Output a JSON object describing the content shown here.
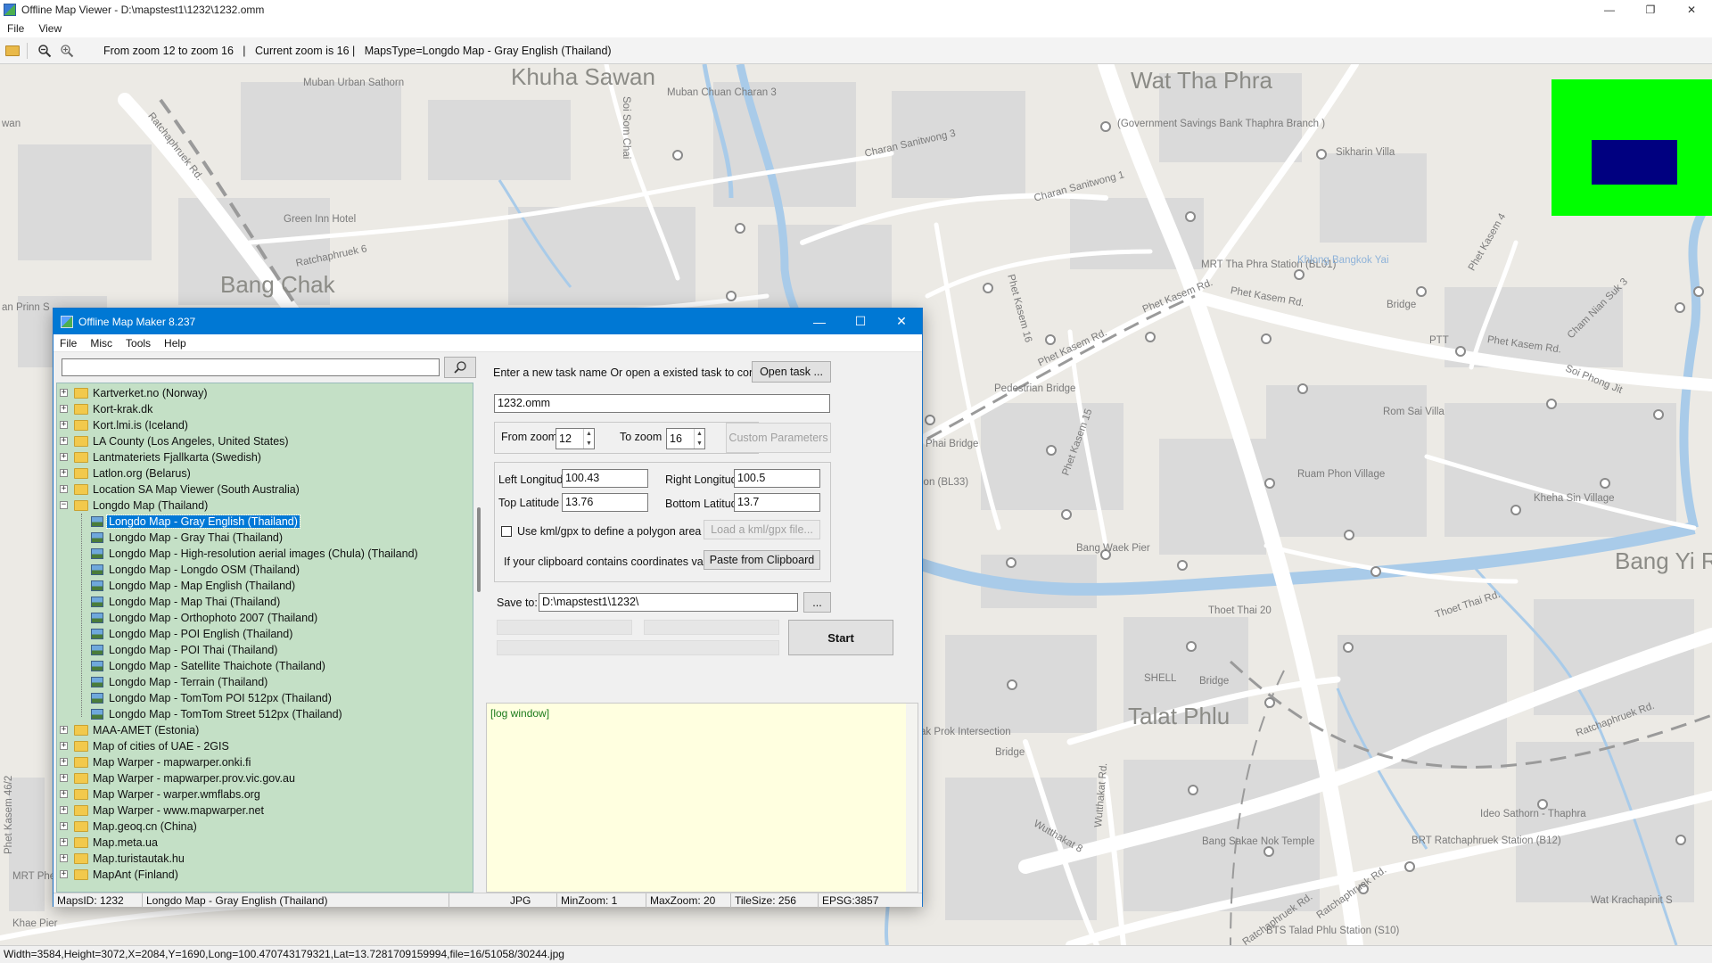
{
  "window": {
    "title": "Offline Map Viewer - D:\\mapstest1\\1232\\1232.omm",
    "controls": {
      "minimize": "—",
      "maximize": "❐",
      "close": "✕"
    }
  },
  "menu": {
    "file": "File",
    "view": "View"
  },
  "toolbar": {
    "icons": [
      "open-folder-icon",
      "zoom-out-icon",
      "zoom-in-icon"
    ],
    "info": "From zoom 12 to zoom 16   |   Current zoom is 16 |   MapsType=Longdo Map - Gray English (Thailand)"
  },
  "map": {
    "labels": {
      "khuha_sawan": "Khuha Sawan",
      "wat_tha_phra": "Wat Tha Phra",
      "bang_chak": "Bang Chak",
      "talat_phlu": "Talat Phlu",
      "bang_yi_r": "Bang Yi R",
      "muban_urban": "Muban Urban Sathorn",
      "muban_chuan": "Muban Chuan Charan 3",
      "charan_sanitwong3": "Charan Sanitwong 3",
      "charan_sanitwong1": "Charan Sanitwong 1",
      "gsb": "(Government Savings Bank Thaphra Branch )",
      "sikharin": "Sikharin Villa",
      "green_inn": "Green Inn Hotel",
      "ratchaphruek6": "Ratchaphruek 6",
      "ratchaphruek_rd": "Ratchaphruek Rd.",
      "mrt_tha_phra": "MRT Tha Phra Station (BL01)",
      "khlong": "Khlong Bangkok Yai",
      "phet_kasem_rd1": "Phet Kasem Rd.",
      "phet_kasem_rd2": "Phet Kasem Rd.",
      "phet_kasem_rd3": "Phet Kasem Rd.",
      "phet_kasem_rd4": "Phet Kasem Rd.",
      "bridge1": "Bridge",
      "ptt": "PTT",
      "soi_phong": "Soi Phong Jit",
      "cham_nian": "Cham Nian Suk 3",
      "phet_kasem4": "Phet Kasem 4",
      "phet_kasem16": "Phet Kasem 16",
      "pedestrian": "Pedestrian Bridge",
      "phai_bridge": "Phai Bridge",
      "phet_kasem15": "Phet Kasem 15",
      "rom_sai": "Rom Sai Villa",
      "ruam_phon": "Ruam Phon Village",
      "kheha_sin": "Kheha Sin Village",
      "ion_bl33": "ion (BL33)",
      "bang_waek": "Bang Waek Pier",
      "thoet_thai20": "Thoet Thai 20",
      "thoet_thai_rd": "Thoet Thai Rd.",
      "shell": "SHELL",
      "bridge2": "Bridge",
      "bridge3": "Bridge",
      "ak_prok": "ak Prok Intersection",
      "ratchaphruek_rd2": "Ratchaphruek Rd.",
      "ratchaphruek_rd3": "Ratchaphruek Rd.",
      "ratchaphruek_rd4": "Ratchaphruek Rd.",
      "wutthakat8": "Wutthakat 8",
      "wutthakat_rd": "Wutthakat Rd.",
      "ideo": "Ideo Sathorn - Thaphra",
      "bang_sakae": "Bang Sakae Nok Temple",
      "brt": "BRT Ratchaphruek Station (B12)",
      "wat_krachapinit": "Wat Krachapinit S",
      "bts_talad": "BTS Talad Phlu Station (S10)",
      "phet_kasem46": "Phet Kasem 46/2",
      "mrt_phe": "MRT Phe",
      "khae_pier": "Khae Pier",
      "wan": "wan",
      "an_prinn": "an Prinn S",
      "soi_som_chai": "Soi Som Chai"
    }
  },
  "statusbar": "Width=3584,Height=3072,X=2084,Y=1690,Long=100.470743179321,Lat=13.7281709159994,file=16/51058/30244.jpg",
  "dialog": {
    "title": "Offline Map Maker 8.237",
    "controls": {
      "minimize": "—",
      "maximize": "☐",
      "close": "✕"
    },
    "menu": {
      "file": "File",
      "misc": "Misc",
      "tools": "Tools",
      "help": "Help"
    },
    "search": {
      "value": "",
      "placeholder": ""
    },
    "tree": {
      "top_items": [
        "Kartverket.no (Norway)",
        "Kort-krak.dk",
        "Kort.lmi.is (Iceland)",
        "LA County (Los Angeles, United States)",
        "Lantmateriets Fjallkarta (Swedish)",
        "Latlon.org (Belarus)",
        "Location SA Map Viewer (South Australia)"
      ],
      "expanded_folder": "Longdo Map (Thailand)",
      "children": [
        "Longdo Map - Gray English (Thailand)",
        "Longdo Map - Gray Thai (Thailand)",
        "Longdo Map - High-resolution aerial images (Chula) (Thailand)",
        "Longdo Map - Longdo OSM (Thailand)",
        "Longdo Map - Map English (Thailand)",
        "Longdo Map - Map Thai (Thailand)",
        "Longdo Map - Orthophoto 2007 (Thailand)",
        "Longdo Map - POI English (Thailand)",
        "Longdo Map - POI Thai (Thailand)",
        "Longdo Map - Satellite Thaichote (Thailand)",
        "Longdo Map - Terrain (Thailand)",
        "Longdo Map - TomTom POI 512px (Thailand)",
        "Longdo Map - TomTom Street 512px (Thailand)"
      ],
      "bottom_items": [
        "MAA-AMET (Estonia)",
        "Map of cities of UAE - 2GIS",
        "Map Warper - mapwarper.onki.fi",
        "Map Warper - mapwarper.prov.vic.gov.au",
        "Map Warper - warper.wmflabs.org",
        "Map Warper - www.mapwarper.net",
        "Map.geoq.cn (China)",
        "Map.meta.ua",
        "Map.turistautak.hu",
        "MapAnt (Finland)"
      ]
    },
    "task": {
      "prompt": "Enter a new task name Or open a existed task to continue:",
      "open_task": "Open task ...",
      "task_name": "1232.omm"
    },
    "zoom": {
      "from_label": "From zoom",
      "from_value": "12",
      "to_label": "To zoom",
      "to_value": "16",
      "custom_params": "Custom Parameters"
    },
    "coords": {
      "left_lon_label": "Left Longitude",
      "left_lon": "100.43",
      "right_lon_label": "Right Longitude",
      "right_lon": "100.5",
      "top_lat_label": "Top Latitude",
      "top_lat": "13.76",
      "bottom_lat_label": "Bottom Latitude",
      "bottom_lat": "13.7",
      "kml_label": "Use kml/gpx to define a polygon area",
      "load_kml": "Load a kml/gpx file...",
      "clipboard_label": "If your clipboard contains coordinates values:",
      "paste_clipboard": "Paste from Clipboard"
    },
    "save": {
      "label": "Save to:",
      "path": "D:\\mapstest1\\1232\\",
      "browse": "..."
    },
    "start": "Start",
    "log": "[log window]",
    "status": {
      "maps_id": "MapsID: 1232",
      "map_name": "Longdo Map - Gray English (Thailand)",
      "format": "JPG",
      "min_zoom": "MinZoom: 1",
      "max_zoom": "MaxZoom: 20",
      "tile_size": "TileSize: 256",
      "epsg": "EPSG:3857"
    }
  },
  "colors": {
    "map_bg": "#eceae5",
    "road": "#ffffff",
    "water": "#a9cbe9",
    "block": "#d9d9d9",
    "title_blue": "#0078d4",
    "tree_bg": "#c4e0c6",
    "log_bg": "#ffffe0",
    "overview_green": "#00ff00",
    "overview_navy": "#000080"
  }
}
